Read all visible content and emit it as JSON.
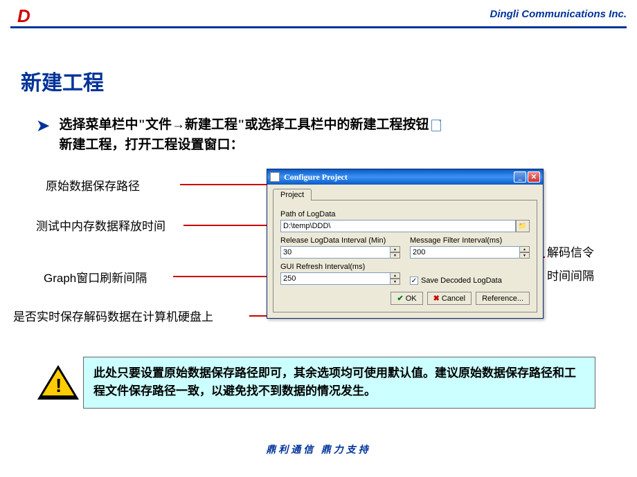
{
  "header": {
    "logo": "D",
    "company": "Dingli Communications Inc."
  },
  "title": "新建工程",
  "bullet": {
    "arrow": "➤",
    "line1_pre": "选择菜单栏中\"文件",
    "line1_arrow": "→",
    "line1_post": "新建工程\"或选择工具栏中的新建工程按钮",
    "line2": "新建工程，打开工程设置窗口："
  },
  "annotations": {
    "a1": "原始数据保存路径",
    "a2": "测试中内存数据释放时间",
    "a3": "Graph窗口刷新间隔",
    "a4": "是否实时保存解码数据在计算机硬盘上",
    "a5_1": "解码信令",
    "a5_2": "时间间隔"
  },
  "dialog": {
    "title": "Configure Project",
    "tab": "Project",
    "path_label": "Path of LogData",
    "path_value": "D:\\temp\\DDD\\",
    "release_label": "Release LogData Interval (Min)",
    "release_value": "30",
    "filter_label": "Message Filter Interval(ms)",
    "filter_value": "200",
    "gui_label": "GUI Refresh Interval(ms)",
    "gui_value": "250",
    "save_cb": "Save Decoded LogData",
    "ok": "OK",
    "cancel": "Cancel",
    "reference": "Reference..."
  },
  "warning": "此处只要设置原始数据保存路径即可，其余选项均可使用默认值。建议原始数据保存路径和工程文件保存路径一致，以避免找不到数据的情况发生。",
  "footer": "鼎利通信  鼎力支持"
}
